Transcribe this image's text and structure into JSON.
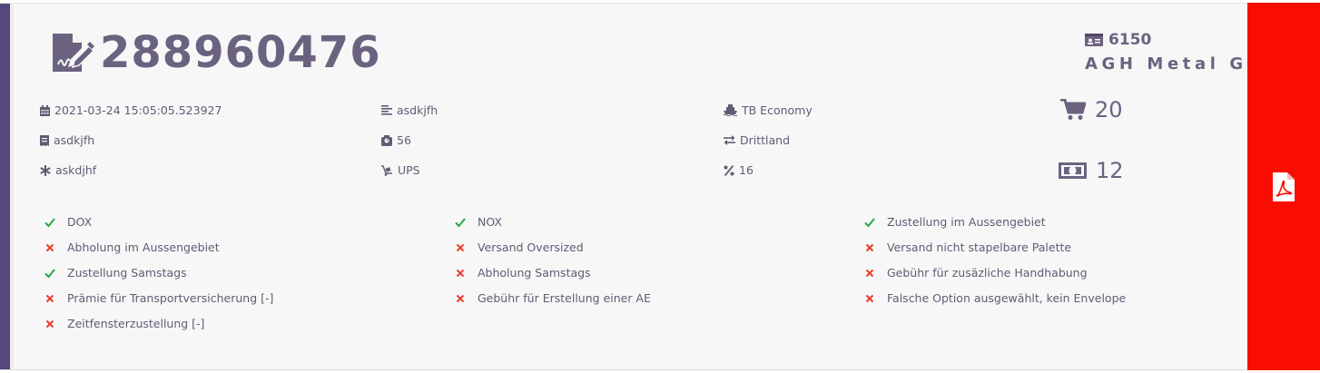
{
  "header": {
    "order_number": "288960476",
    "company_id": "6150",
    "company_name": "AGH Metal Gr"
  },
  "info": {
    "datetime": "2021-03-24 15:05:05.523927",
    "reference": "asdkjfh",
    "service": "TB Economy",
    "invoice_ref": "asdkjfh",
    "weight": "56",
    "region": "Drittland",
    "note": "askdjhf",
    "carrier": "UPS",
    "discount": "16"
  },
  "stats": {
    "cart_count": "20",
    "price": "12"
  },
  "options": [
    {
      "label": "DOX",
      "status": "check"
    },
    {
      "label": "NOX",
      "status": "check"
    },
    {
      "label": "Zustellung im Aussengebiet",
      "status": "check"
    },
    {
      "label": "Abholung im Aussengebiet",
      "status": "cross"
    },
    {
      "label": "Versand Oversized",
      "status": "cross"
    },
    {
      "label": "Versand nicht stapelbare Palette",
      "status": "cross"
    },
    {
      "label": "Zustellung Samstags",
      "status": "check"
    },
    {
      "label": "Abholung Samstags",
      "status": "cross"
    },
    {
      "label": "Gebühr für zusäzliche Handhabung",
      "status": "cross"
    },
    {
      "label": "Prämie für Transportversicherung [-]",
      "status": "cross"
    },
    {
      "label": "Gebühr für Erstellung einer AE",
      "status": "cross"
    },
    {
      "label": "Falsche Option ausgewählt, kein Envelope",
      "status": "cross"
    },
    {
      "label": "Zeitfensterzustellung [-]",
      "status": "cross"
    }
  ],
  "colors": {
    "accent": "#55487e",
    "text": "#6b6280",
    "check": "#28a745",
    "cross": "#ea3b2c",
    "pdf_panel": "#f80d00"
  },
  "icons": {
    "title": "file-signature-icon",
    "company": "id-card-icon",
    "pdf": "file-pdf-icon"
  }
}
